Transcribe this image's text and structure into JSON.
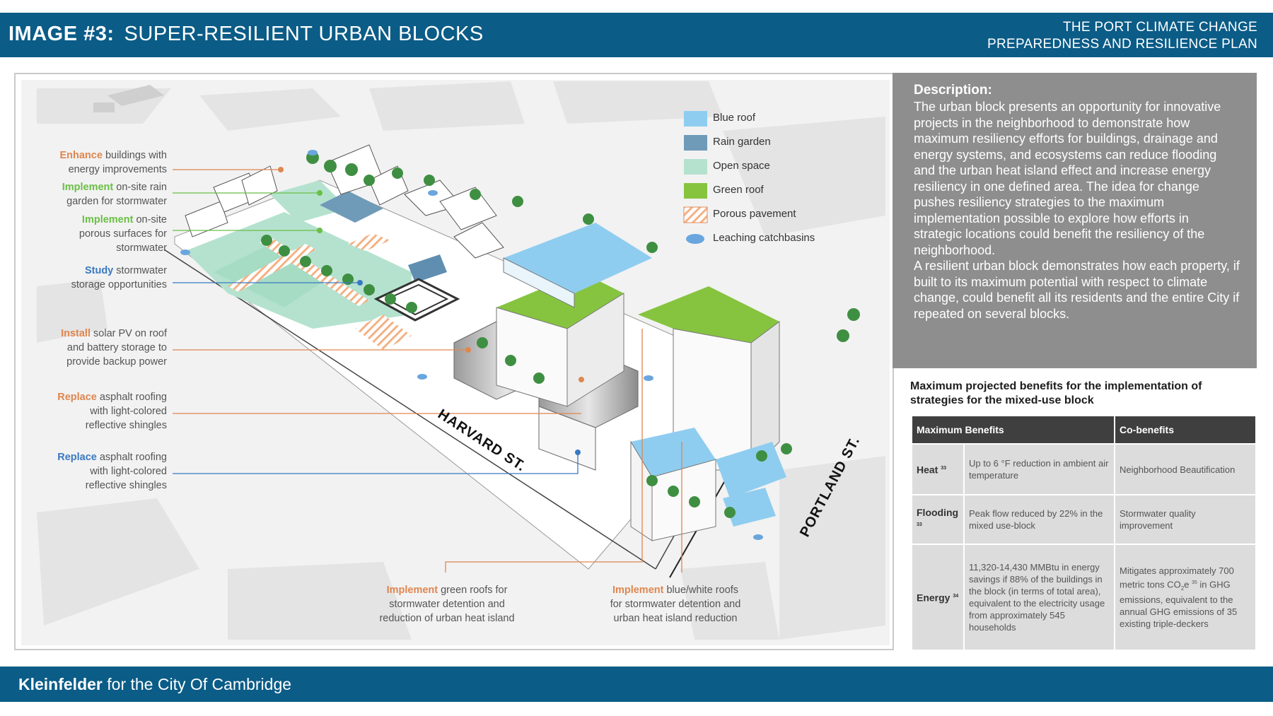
{
  "header": {
    "image_label": "IMAGE #3:",
    "title": "SUPER-RESILIENT URBAN BLOCKS",
    "plan_line1": "THE PORT CLIMATE CHANGE",
    "plan_line2": "PREPAREDNESS AND RESILIENCE PLAN"
  },
  "footer": {
    "org": "Kleinfelder",
    "suffix": "for the City Of Cambridge"
  },
  "description": {
    "heading": "Description:",
    "para1": "The urban block presents an opportunity for innovative projects in the neighborhood to demonstrate how maximum resiliency efforts for buildings, drainage and energy systems, and ecosystems can reduce flooding and the urban heat island effect and increase energy resiliency in one defined area. The idea for change pushes resiliency strategies to the maximum implementation possible to explore how efforts in strategic locations could benefit the resiliency of the neighborhood.",
    "para2": "A resilient urban block demonstrates how each property, if built to its maximum potential with respect to climate change, could benefit all its residents and the entire City if repeated on several blocks."
  },
  "benefits": {
    "title": "Maximum projected benefits for the implementation of strategies for the mixed-use block",
    "col1": "Maximum Benefits",
    "col2": "Co-benefits",
    "rows": [
      {
        "key": "Heat",
        "ref": "33",
        "max": "Up to 6 °F reduction in ambient air temperature",
        "co": "Neighborhood Beautification"
      },
      {
        "key": "Flooding",
        "ref": "33",
        "max": "Peak flow reduced by 22% in the mixed use-block",
        "co": "Stormwater quality improvement"
      },
      {
        "key": "Energy",
        "ref": "34",
        "max": "11,320-14,430 MMBtu in energy savings if 88% of the buildings in the block (in terms of total area), equivalent to the electricity usage from approximately 545 households",
        "co_a": "Mitigates approximately 700 metric tons CO",
        "co_sub": "2",
        "co_b": "e",
        "co_ref": "35",
        "co_c": " in GHG emissions, equivalent to the annual GHG emissions of 35 existing triple-deckers"
      }
    ]
  },
  "legend": {
    "items": [
      {
        "label": "Blue roof",
        "color": "#8fcdf0"
      },
      {
        "label": "Rain garden",
        "color": "#6f9bb8"
      },
      {
        "label": "Open space",
        "color": "#b4e2cf"
      },
      {
        "label": "Green roof",
        "color": "#86c440"
      },
      {
        "label": "Porous pavement",
        "color": "#f4b184"
      },
      {
        "label": "Leaching catchbasins",
        "color": "#6aa6dd"
      }
    ]
  },
  "annotations": {
    "a1": {
      "verb": "Enhance",
      "rest1": " buildings with",
      "line2": "energy improvements",
      "color": "#e0864f"
    },
    "a2": {
      "verb": "Implement",
      "rest1": " on-site rain",
      "line2": "garden for stormwater",
      "color": "#6abf45"
    },
    "a3": {
      "verb": "Implement",
      "rest1": " on-site",
      "line2": "porous surfaces for",
      "line3": "stormwater",
      "color": "#6abf45"
    },
    "a4": {
      "verb": "Study",
      "rest1": " stormwater",
      "line2": "storage opportunities",
      "color": "#3a79c2"
    },
    "a5": {
      "verb": "Install",
      "rest1": " solar PV on roof",
      "line2": "and battery storage to",
      "line3": "provide backup power",
      "color": "#e0864f"
    },
    "a6": {
      "verb": "Replace",
      "rest1": " asphalt roofing",
      "line2": "with light-colored",
      "line3": "reflective shingles",
      "color": "#e0864f"
    },
    "a7": {
      "verb": "Replace",
      "rest1": " asphalt roofing",
      "line2": "with light-colored",
      "line3": "reflective shingles",
      "color": "#3a79c2"
    },
    "a8": {
      "verb": "Implement",
      "rest1": " green roofs for",
      "line2": "stormwater detention and",
      "line3": "reduction of urban heat island",
      "color": "#e0864f"
    },
    "a9": {
      "verb": "Implement",
      "rest1": " blue/white roofs",
      "line2": "for stormwater detention and",
      "line3": "urban heat island reduction",
      "color": "#e0864f"
    }
  },
  "streets": {
    "harvard": "HARVARD ST.",
    "portland": "PORTLAND ST."
  }
}
